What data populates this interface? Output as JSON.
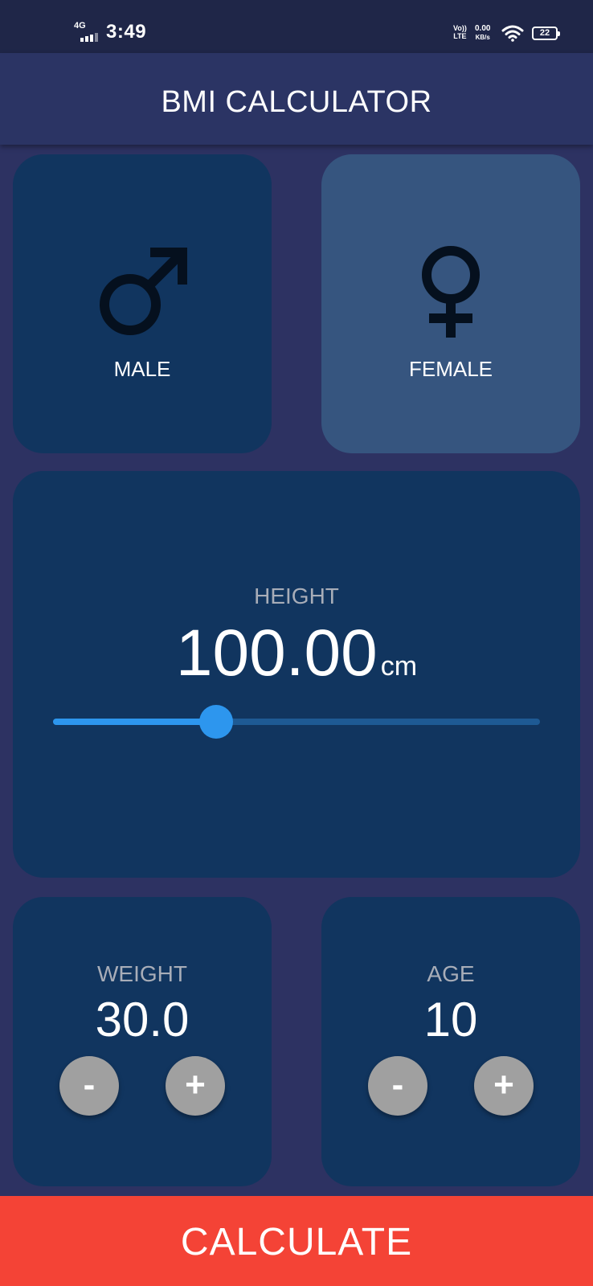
{
  "status_bar": {
    "network": "4G",
    "time": "3:49",
    "volte_top": "Vo))",
    "volte_bottom": "LTE",
    "speed_value": "0.00",
    "speed_unit": "KB/s",
    "battery": "22",
    "icons": [
      "signal-icon",
      "wifi-icon",
      "battery-icon"
    ]
  },
  "app_bar": {
    "title": "BMI CALCULATOR"
  },
  "gender": {
    "male_label": "MALE",
    "female_label": "FEMALE",
    "selected": "female",
    "male_icon": "male-symbol-icon",
    "female_icon": "female-symbol-icon"
  },
  "height": {
    "label": "HEIGHT",
    "value": "100.00",
    "unit": "cm",
    "slider_fraction": 0.335
  },
  "weight": {
    "label": "WEIGHT",
    "value": "30.0",
    "minus_label": "-",
    "plus_label": "+"
  },
  "age": {
    "label": "AGE",
    "value": "10",
    "minus_label": "-",
    "plus_label": "+"
  },
  "calculate": {
    "label": "CALCULATE"
  },
  "colors": {
    "background": "#2d3262",
    "status_bar": "#1f2648",
    "app_bar": "#2b3464",
    "card": "#11355f",
    "card_selected": "#36557f",
    "slider_active": "#2d96ee",
    "slider_inactive": "#1e5a94",
    "round_button": "#a0a0a0",
    "calculate_button": "#f44336"
  }
}
